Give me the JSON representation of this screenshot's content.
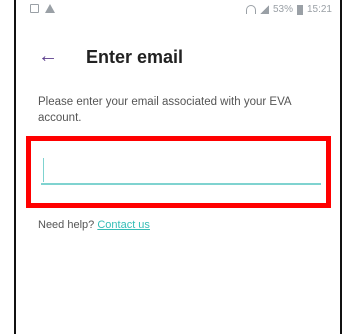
{
  "statusbar": {
    "left_icons": [
      "image-icon",
      "warning-icon"
    ],
    "right_text": "53%",
    "time": "15:21"
  },
  "header": {
    "back_icon": "arrow-left-icon",
    "title": "Enter email"
  },
  "form": {
    "instruction": "Please enter your email associated with your EVA account.",
    "email_value": "",
    "email_placeholder": ""
  },
  "help": {
    "prefix": "Need help?",
    "link_label": "Contact us"
  },
  "colors": {
    "accent": "#35bdb6",
    "back_arrow": "#5b3d8c",
    "highlight": "#ff0000"
  }
}
